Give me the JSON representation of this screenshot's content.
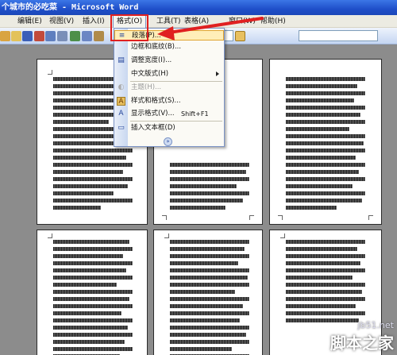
{
  "window": {
    "title": "个城市的必吃菜 - Microsoft Word"
  },
  "menubar": {
    "items": [
      {
        "label": "编辑(E)",
        "key": "edit"
      },
      {
        "label": "视图(V)",
        "key": "view"
      },
      {
        "label": "插入(I)",
        "key": "insert"
      },
      {
        "label": "格式(O)",
        "key": "format",
        "open": true
      },
      {
        "label": "工具(T)",
        "key": "tools"
      },
      {
        "label": "表格(A)",
        "key": "table"
      },
      {
        "label": "窗口(W)",
        "key": "window"
      },
      {
        "label": "帮助(H)",
        "key": "help"
      }
    ]
  },
  "format_menu": {
    "items": [
      {
        "label": "段落(P)...",
        "icon": "paragraph-icon",
        "highlighted": true
      },
      {
        "label": "边框和底纹(B)...",
        "icon": ""
      },
      {
        "label": "调整宽度(I)...",
        "icon": "fit-width-icon"
      },
      {
        "label": "中文版式(H)",
        "icon": "",
        "submenu": true
      },
      {
        "label": "主题(H)...",
        "icon": "theme-icon",
        "disabled": true
      },
      {
        "label": "样式和格式(S)...",
        "icon": "styles-icon"
      },
      {
        "label": "显示格式(V)...",
        "icon": "reveal-format-icon",
        "shortcut": "Shift+F1"
      },
      {
        "label": "插入文本框(D)",
        "icon": "textbox-icon"
      }
    ],
    "expand_glyph": "»"
  },
  "watermark": {
    "url": "jb51.net",
    "name": "脚本之家"
  },
  "colors": {
    "highlight": "#e02020",
    "titlebar": "#1f4fc9"
  }
}
